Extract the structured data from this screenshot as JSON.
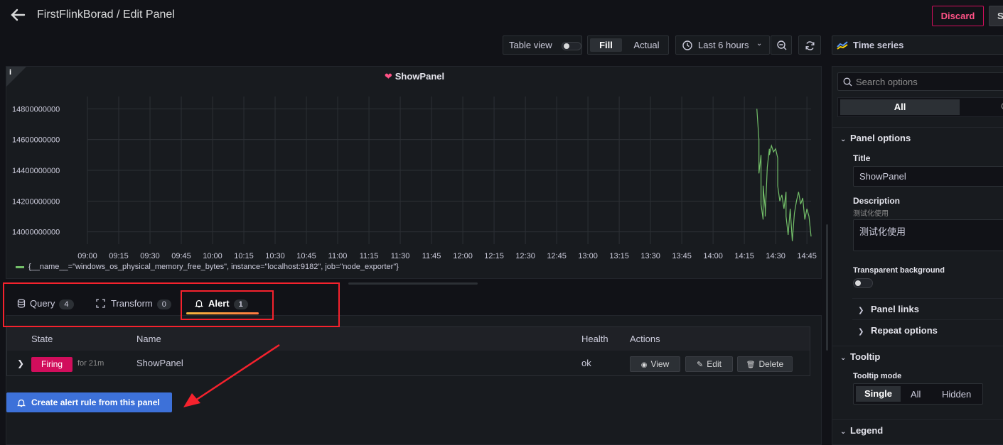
{
  "header": {
    "breadcrumb": "FirstFlinkBorad / Edit Panel",
    "discard_label": "Discard",
    "save_label": "S"
  },
  "toolbar": {
    "table_view_label": "Table view",
    "fill_label": "Fill",
    "actual_label": "Actual",
    "time_range": "Last 6 hours",
    "visualization": "Time series"
  },
  "panel": {
    "title": "ShowPanel",
    "info_icon": "i",
    "legend": "{__name__=\"windows_os_physical_memory_free_bytes\", instance=\"localhost:9182\", job=\"node_exporter\"}"
  },
  "chart_data": {
    "type": "line",
    "y_ticks": [
      "14800000000",
      "14600000000",
      "14400000000",
      "14200000000",
      "14000000000"
    ],
    "y_tick_values": [
      14800000000,
      14600000000,
      14400000000,
      14200000000,
      14000000000
    ],
    "x_ticks": [
      "09:00",
      "09:15",
      "09:30",
      "09:45",
      "10:00",
      "10:15",
      "10:30",
      "10:45",
      "11:00",
      "11:15",
      "11:30",
      "11:45",
      "12:00",
      "12:15",
      "12:30",
      "12:45",
      "13:00",
      "13:15",
      "13:30",
      "13:45",
      "14:00",
      "14:15",
      "14:30",
      "14:45"
    ],
    "ylim": [
      13920000000,
      14880000000
    ],
    "xlim": [
      "09:00",
      "14:47"
    ],
    "grid": true,
    "series": [
      {
        "name": "{__name__=\"windows_os_physical_memory_free_bytes\", instance=\"localhost:9182\", job=\"node_exporter\"}",
        "color": "#73bf69",
        "x": [
          "14:21",
          "14:22",
          "14:22",
          "14:23",
          "14:23",
          "14:24",
          "14:24",
          "14:25",
          "14:25",
          "14:26",
          "14:27",
          "14:27",
          "14:28",
          "14:29",
          "14:30",
          "14:31",
          "14:31",
          "14:32",
          "14:33",
          "14:34",
          "14:35",
          "14:35",
          "14:36",
          "14:37",
          "14:38",
          "14:39",
          "14:40",
          "14:41",
          "14:42",
          "14:43",
          "14:44",
          "14:45",
          "14:46",
          "14:47"
        ],
        "y": [
          14800000000,
          14600000000,
          14380000000,
          14500000000,
          14180000000,
          14080000000,
          14300000000,
          14150000000,
          14100000000,
          14420000000,
          14540000000,
          14500000000,
          14560000000,
          14520000000,
          14540000000,
          14480000000,
          14300000000,
          14200000000,
          14240000000,
          14150000000,
          14260000000,
          14100000000,
          13980000000,
          14150000000,
          13940000000,
          14120000000,
          14200000000,
          14260000000,
          14180000000,
          14220000000,
          14080000000,
          14150000000,
          14100000000,
          13970000000
        ]
      }
    ]
  },
  "tabs": [
    {
      "label": "Query",
      "count": "4"
    },
    {
      "label": "Transform",
      "count": "0"
    },
    {
      "label": "Alert",
      "count": "1"
    }
  ],
  "alert_table": {
    "headers": {
      "state": "State",
      "name": "Name",
      "health": "Health",
      "actions": "Actions"
    },
    "row": {
      "state": "Firing",
      "duration": "for 21m",
      "name": "ShowPanel",
      "health": "ok",
      "view": "View",
      "edit": "Edit",
      "delete": "Delete"
    }
  },
  "create_alert_label": "Create alert rule from this panel",
  "options": {
    "search_placeholder": "Search options",
    "seg_all": "All",
    "seg_other": "C",
    "panel_options": "Panel options",
    "title_label": "Title",
    "title_value": "ShowPanel",
    "description_label": "Description",
    "description_hint": "测试化使用",
    "description_value": "测试化使用",
    "transparent_label": "Transparent background",
    "panel_links": "Panel links",
    "repeat_options": "Repeat options",
    "tooltip": "Tooltip",
    "tooltip_mode_label": "Tooltip mode",
    "tooltip_modes": [
      "Single",
      "All",
      "Hidden"
    ],
    "legend": "Legend"
  }
}
